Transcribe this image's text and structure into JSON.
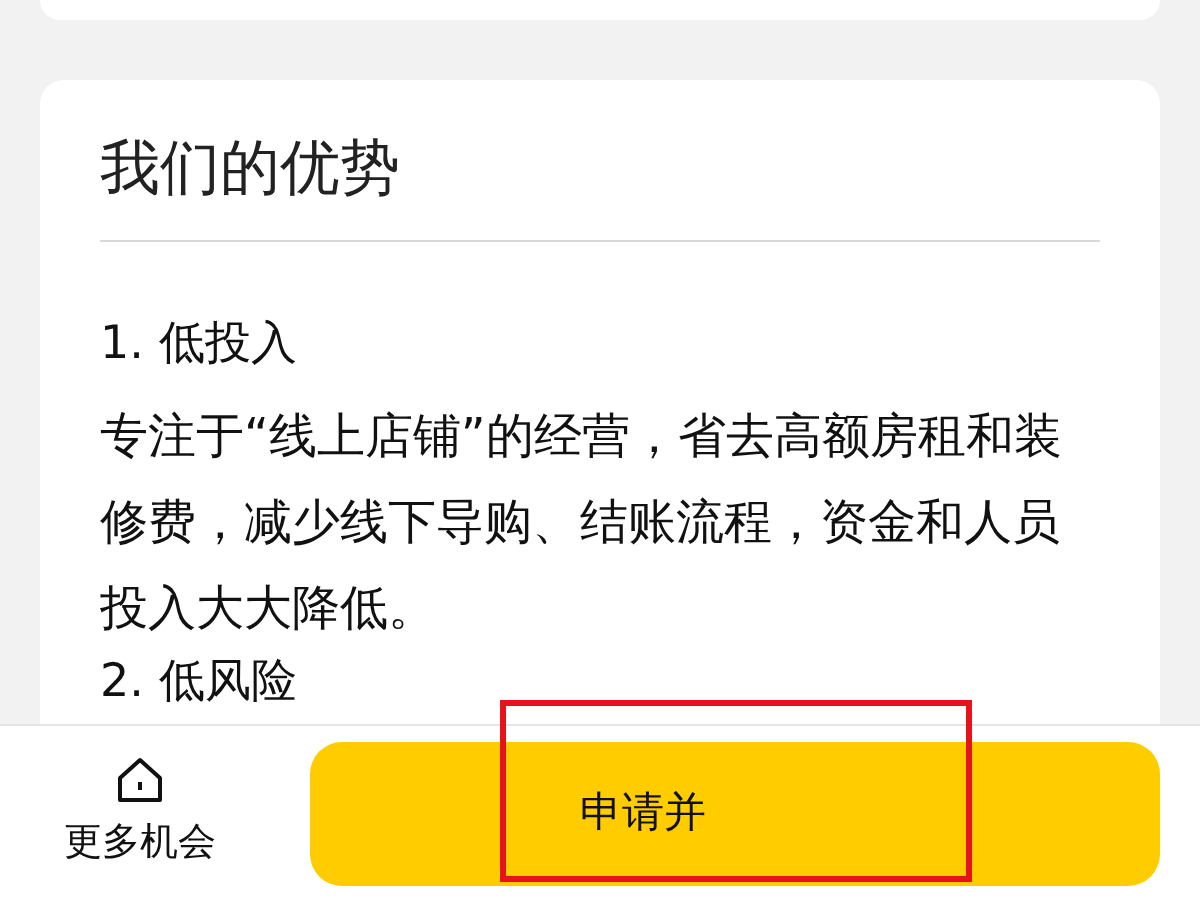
{
  "section": {
    "title": "我们的优势",
    "items": [
      {
        "heading": "1. 低投入",
        "body": "专注于“线上店铺”的经营，省去高额房租和装修费，减少线下导购、结账流程，资金和人员投入大大降低。"
      },
      {
        "heading": "2. 低风险"
      }
    ]
  },
  "bottom_bar": {
    "nav_label": "更多机会",
    "button_label": "申请并"
  }
}
